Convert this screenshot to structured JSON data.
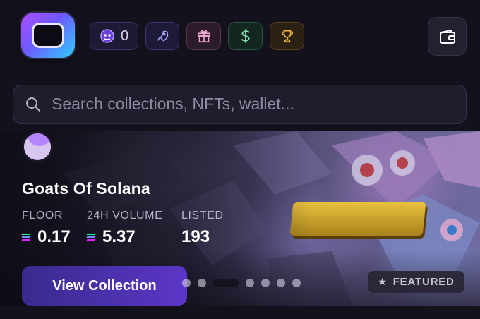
{
  "header": {
    "level_count": "0",
    "icons": [
      "level-badge-icon",
      "rocket-icon",
      "gift-icon",
      "dollar-icon",
      "trophy-icon",
      "wallet-icon"
    ]
  },
  "search": {
    "placeholder": "Search collections, NFTs, wallet...",
    "value": ""
  },
  "featured_collection": {
    "name": "Goats Of Solana",
    "badge": "FEATURED",
    "cta_label": "View Collection",
    "carousel_slide_count": 7,
    "carousel_active_index": 2,
    "stats": [
      {
        "label": "FLOOR",
        "value": "0.17",
        "currency_icon": "solana-icon"
      },
      {
        "label": "24H VOLUME",
        "value": "5.37",
        "currency_icon": "solana-icon"
      },
      {
        "label": "LISTED",
        "value": "193"
      }
    ]
  },
  "colors": {
    "background": "#13111c",
    "chip_purple": "#3a3469",
    "chip_pink": "#5a3450",
    "chip_green": "#2a5444",
    "chip_gold": "#5c4622",
    "cta_gradient_start": "#3a2a8c",
    "cta_gradient_end": "#5b36c8"
  }
}
